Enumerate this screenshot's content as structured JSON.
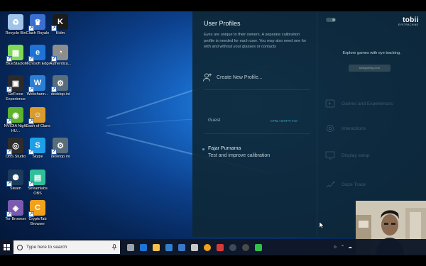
{
  "desktop_icons": [
    {
      "label": "Recycle Bin",
      "color": "#9fc4e8",
      "glyph": "♻"
    },
    {
      "label": "Clash Royale",
      "color": "#3a6fd0",
      "glyph": "♛"
    },
    {
      "label": "Kidm",
      "color": "#1b1b1b",
      "glyph": "K"
    },
    {
      "label": "BlueStacks",
      "color": "#7ed957",
      "glyph": "▦"
    },
    {
      "label": "Microsoft Edge",
      "color": "#1d74d6",
      "glyph": "e"
    },
    {
      "label": "Authentica...",
      "color": "#8d8d8d",
      "glyph": "◔"
    },
    {
      "label": "GeForce Experience",
      "color": "#2b2b2b",
      "glyph": "▣"
    },
    {
      "label": "Webchann...",
      "color": "#2a7fd4",
      "glyph": "W"
    },
    {
      "label": "desktop.ini",
      "color": "#5a6d7a",
      "glyph": "⚙"
    },
    {
      "label": "NVIDIA Night HU...",
      "color": "#5fb22e",
      "glyph": "◉"
    },
    {
      "label": "Clash of Clans",
      "color": "#d99b2b",
      "glyph": "☺"
    },
    {
      "label": "OBS Studio",
      "color": "#2d2d2d",
      "glyph": "◎"
    },
    {
      "label": "Skype",
      "color": "#1ea0e8",
      "glyph": "S"
    },
    {
      "label": "desktop.ini",
      "color": "#5a6d7a",
      "glyph": "⚙"
    },
    {
      "label": "Steam",
      "color": "#1a3b5c",
      "glyph": "⚉"
    },
    {
      "label": "Streamlabs OBS",
      "color": "#2fbf9a",
      "glyph": "▤"
    },
    {
      "label": "Tor Browser",
      "color": "#7a5bb0",
      "glyph": "◈"
    },
    {
      "label": "CryptoTab Browser",
      "color": "#f0a21c",
      "glyph": "C"
    }
  ],
  "tobii": {
    "title": "User Profiles",
    "intro": "Eyes are unique to their owners. A separate calibration profile is needed for each user. You may also need one for with and without your glasses or contacts",
    "create_label": "Create New Profile...",
    "guest_label": "Guest",
    "guest_shortcut": "CTRL+SHIFT+F10",
    "profile_name": "Fajar Purnama",
    "profile_action": "Test and improve calibration",
    "logo_name": "tobii",
    "logo_sub": "EYETRACKING",
    "explore_text": "Explore games with eye tracking.",
    "explore_button": "tobiigaming.com",
    "menu": [
      {
        "label": "Games and Experiences",
        "icon": "game-icon"
      },
      {
        "label": "Interactions",
        "icon": "gear-icon"
      },
      {
        "label": "Display setup",
        "icon": "display-icon"
      },
      {
        "label": "Gaze Trace",
        "icon": "gaze-trace-icon"
      }
    ],
    "accent": "#3fb0c9"
  },
  "taskbar": {
    "search_placeholder": "Type here to search",
    "apps": [
      {
        "name": "task-view",
        "color": "#9aa3ad"
      },
      {
        "name": "edge",
        "color": "#1d74d6"
      },
      {
        "name": "file-explorer",
        "color": "#f2c14e"
      },
      {
        "name": "store",
        "color": "#2f7fd1"
      },
      {
        "name": "mail",
        "color": "#3b78c8"
      },
      {
        "name": "camera",
        "color": "#c7c7c7"
      },
      {
        "name": "cryptotab",
        "color": "#f0a21c"
      },
      {
        "name": "flag-app",
        "color": "#d23b3b"
      },
      {
        "name": "steam",
        "color": "#3c4a5a"
      },
      {
        "name": "obs",
        "color": "#4a4a4a"
      },
      {
        "name": "line",
        "color": "#2fbf4a"
      }
    ]
  }
}
